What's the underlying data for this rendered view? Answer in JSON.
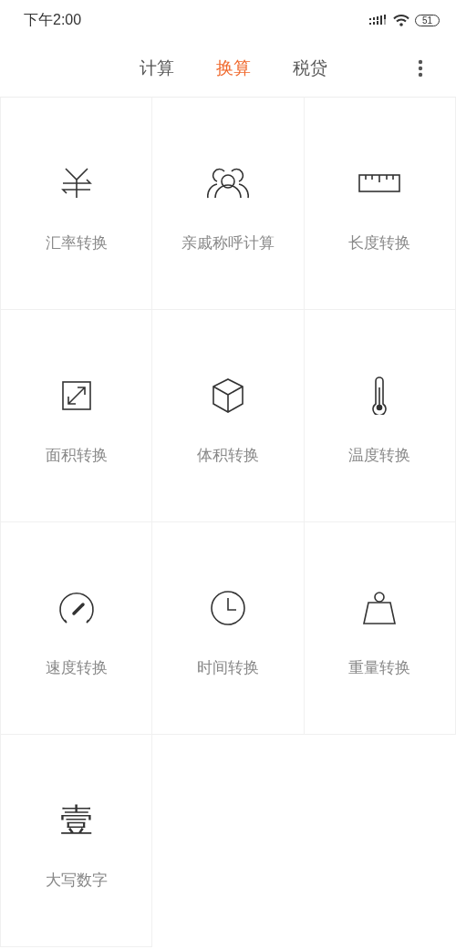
{
  "status_bar": {
    "time": "下午2:00",
    "battery": "51"
  },
  "tabs": [
    {
      "label": "计算",
      "selected": false
    },
    {
      "label": "换算",
      "selected": true
    },
    {
      "label": "税贷",
      "selected": false
    }
  ],
  "tools": [
    {
      "kind": "currency",
      "label": "汇率转换"
    },
    {
      "kind": "relatives",
      "label": "亲戚称呼计算"
    },
    {
      "kind": "length",
      "label": "长度转换"
    },
    {
      "kind": "area",
      "label": "面积转换"
    },
    {
      "kind": "volume",
      "label": "体积转换"
    },
    {
      "kind": "temperature",
      "label": "温度转换"
    },
    {
      "kind": "speed",
      "label": "速度转换"
    },
    {
      "kind": "time",
      "label": "时间转换"
    },
    {
      "kind": "weight",
      "label": "重量转换"
    },
    {
      "kind": "glyph",
      "glyph": "壹",
      "label": "大写数字"
    }
  ]
}
